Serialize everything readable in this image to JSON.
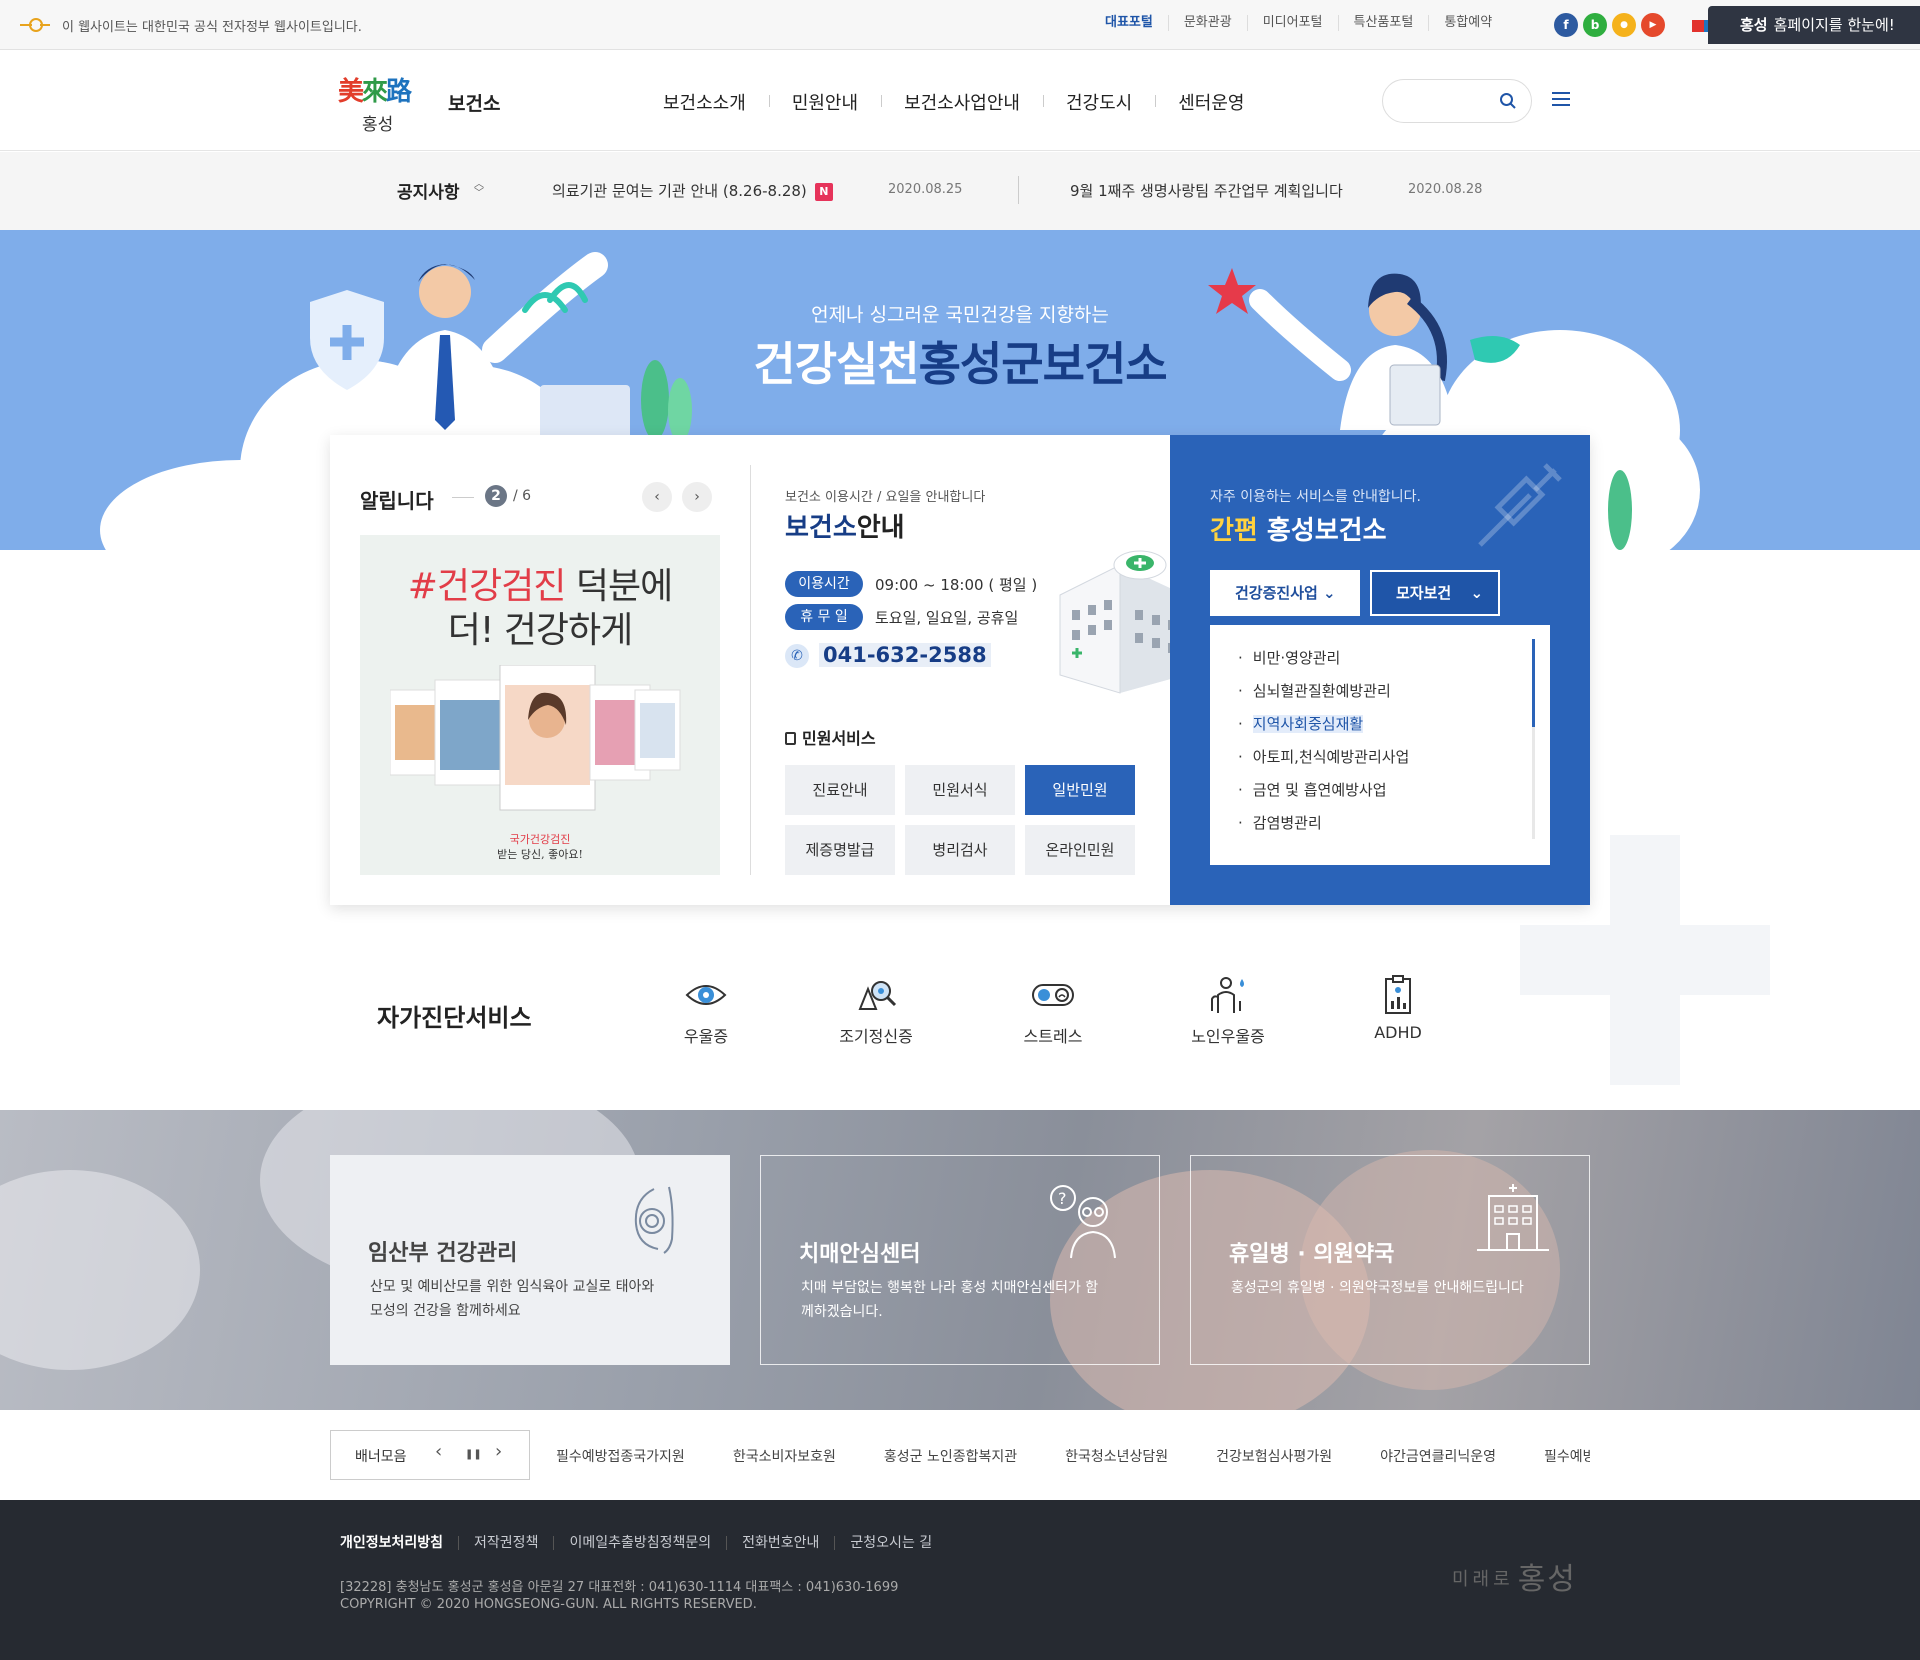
{
  "topbar": {
    "gov_notice": "이 웹사이트는 대한민국 공식 전자정부 웹사이트입니다.",
    "portals": [
      "대표포털",
      "문화관광",
      "미디어포털",
      "특산품포털",
      "통합예약"
    ],
    "sns": [
      {
        "name": "facebook-icon",
        "glyph": "f",
        "color": "#2d5aa0"
      },
      {
        "name": "blog-icon",
        "glyph": "b",
        "color": "#2fae3f"
      },
      {
        "name": "kakao-story-icon",
        "glyph": "●",
        "color": "#f5b21b"
      },
      {
        "name": "youtube-icon",
        "glyph": "▶",
        "color": "#e5492c"
      }
    ],
    "hongseong_tab_bold": "홍성",
    "hongseong_tab_rest": "홈페이지를 한눈에!"
  },
  "header": {
    "logo_hanja": [
      "美",
      "來",
      "路"
    ],
    "logo_sub": "홍성",
    "site_name": "보건소",
    "nav": [
      "보건소소개",
      "민원안내",
      "보건소사업안내",
      "건강도시",
      "센터운영"
    ],
    "search_placeholder": ""
  },
  "notice": {
    "title": "공지사항",
    "items": [
      {
        "text": "의료기관 문여는 기관 안내 (8.26-8.28)",
        "badge": "N",
        "date": "2020.08.25"
      },
      {
        "text": "9월 1째주 생명사랑팀 주간업무 계획입니다",
        "badge": "",
        "date": "2020.08.28"
      }
    ]
  },
  "hero": {
    "subtitle": "언제나 싱그러운 국민건강을 지향하는",
    "title_light": "건강실천",
    "title_dark": "홍성군보건소"
  },
  "notify": {
    "title": "알립니다",
    "current": "2",
    "total": "/ 6",
    "prev": "‹",
    "next": "›",
    "promo_hash": "#건강검진",
    "promo_line1_rest": " 덕분에",
    "promo_line2": "더! 건강하게",
    "promo_foot1": "국가건강검진",
    "promo_foot2": "받는 당신, 좋아요!"
  },
  "info": {
    "label": "보건소 이용시간 / 요일을 안내합니다",
    "title_a": "보건소",
    "title_b": "안내",
    "hours_label": "이용시간",
    "hours": "09:00 ~ 18:00 ( 평일 )",
    "closed_label": "휴 무 일",
    "closed": "토요일, 일요일, 공휴일",
    "phone": "041-632-2588",
    "minwon_title": "민원서비스",
    "services": [
      "진료안내",
      "민원서식",
      "일반민원",
      "제증명발급",
      "병리검사",
      "온라인민원"
    ],
    "active_service": "일반민원"
  },
  "quick": {
    "label": "자주 이용하는 서비스를 안내합니다.",
    "title_yellow": "간편",
    "title_white": "홍성보건소",
    "select1": "건강증진사업",
    "select2": "모자보건",
    "items": [
      "비만·영양관리",
      "심뇌혈관질환예방관리",
      "지역사회중심재활",
      "아토피,천식예방관리사업",
      "금연 및 흡연예방사업",
      "감염병관리"
    ],
    "highlighted": "지역사회중심재활"
  },
  "diagnosis": {
    "title": "자가진단서비스",
    "items": [
      {
        "label": "우울증",
        "icon": "eye-icon"
      },
      {
        "label": "조기정신증",
        "icon": "magnifier-icon"
      },
      {
        "label": "스트레스",
        "icon": "stress-face-icon"
      },
      {
        "label": "노인우울증",
        "icon": "elderly-icon"
      },
      {
        "label": "ADHD",
        "icon": "clipboard-chart-icon"
      }
    ]
  },
  "cards": [
    {
      "title": "임산부 건강관리",
      "desc": "산모 및 예비산모를 위한 임식육아 교실로 태아와 모성의 건강을 함께하세요",
      "icon": "pregnant-icon"
    },
    {
      "title": "치매안심센터",
      "desc": "치매 부담없는 행복한 나라 홍성 치매안심센터가 함께하겠습니다.",
      "icon": "dementia-icon"
    },
    {
      "title": "휴일병 · 의원약국",
      "desc": "홍성군의 휴일병 · 의원약국정보를 안내해드립니다",
      "icon": "hospital-icon"
    }
  ],
  "banners": {
    "label": "배너모음",
    "prev": "‹",
    "pause": "❚❚",
    "next": "›",
    "links": [
      "필수예방접종국가지원",
      "한국소비자보호원",
      "홍성군 노인종합복지관",
      "한국청소년상담원",
      "건강보험심사평가원",
      "야간금연클리닉운영",
      "필수예방접종국가지원"
    ]
  },
  "footer": {
    "links": [
      "개인정보처리방침",
      "저작권정책",
      "이메일추출방침정책문의",
      "전화번호안내",
      "군청오시는 길"
    ],
    "address": "[32228] 충청남도 홍성군 홍성읍 아문길 27 대표전화 : 041)630-1114 대표팩스 : 041)630-1699",
    "copyright": "COPYRIGHT © 2020 HONGSEONG-GUN. ALL RIGHTS RESERVED.",
    "logo_small": "미래로",
    "logo_big": "홍성"
  }
}
